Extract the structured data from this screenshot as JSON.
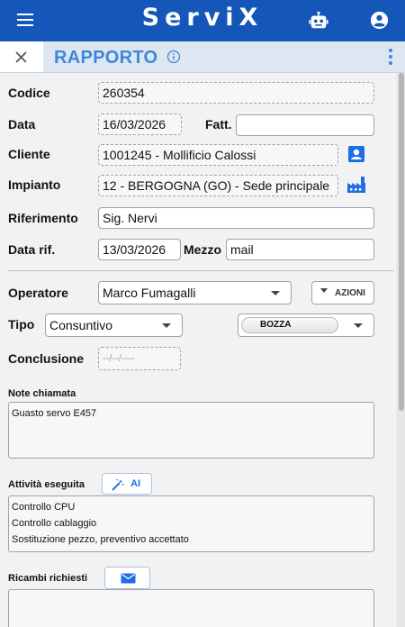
{
  "app": {
    "brand": "ServiX"
  },
  "header": {
    "title": "RAPPORTO"
  },
  "fields": {
    "codice": {
      "label": "Codice",
      "value": "260354"
    },
    "data": {
      "label": "Data",
      "value": "16/03/2026"
    },
    "fatt": {
      "label": "Fatt.",
      "value": ""
    },
    "cliente": {
      "label": "Cliente",
      "value": "1001245 - Mollificio Calossi"
    },
    "impianto": {
      "label": "Impianto",
      "value": "12 - BERGOGNA (GO) - Sede principale"
    },
    "riferimento": {
      "label": "Riferimento",
      "value": "Sig. Nervi"
    },
    "data_rif": {
      "label": "Data rif.",
      "value": "13/03/2026"
    },
    "mezzo": {
      "label": "Mezzo",
      "value": "mail"
    },
    "operatore": {
      "label": "Operatore",
      "value": "Marco Fumagalli"
    },
    "azioni": {
      "label": "AZIONI"
    },
    "tipo": {
      "label": "Tipo",
      "value": "Consuntivo"
    },
    "stato": {
      "value": "BOZZA"
    },
    "conclusione": {
      "label": "Conclusione",
      "placeholder": "--/--/----"
    }
  },
  "note_chiamata": {
    "label": "Note chiamata",
    "lines": [
      "Guasto servo E457"
    ]
  },
  "attivita": {
    "label": "Attività eseguita",
    "ai_label": "AI",
    "lines": [
      "Controllo CPU",
      "Controllo cablaggio",
      "Sostituzione pezzo, preventivo accettato"
    ]
  },
  "ricambi": {
    "label": "Ricambi richiesti",
    "lines": []
  },
  "colors": {
    "primary": "#1457b8",
    "accent": "#3f87d9",
    "subheader": "#dde7f2"
  },
  "icons": {
    "menu": "menu-icon",
    "robot": "robot-icon",
    "account": "account-icon",
    "close": "close-icon",
    "info": "info-icon",
    "more": "more-vert-icon",
    "contact": "contact-card-icon",
    "factory": "factory-icon",
    "magic": "magic-wand-icon",
    "mail": "mail-icon"
  }
}
